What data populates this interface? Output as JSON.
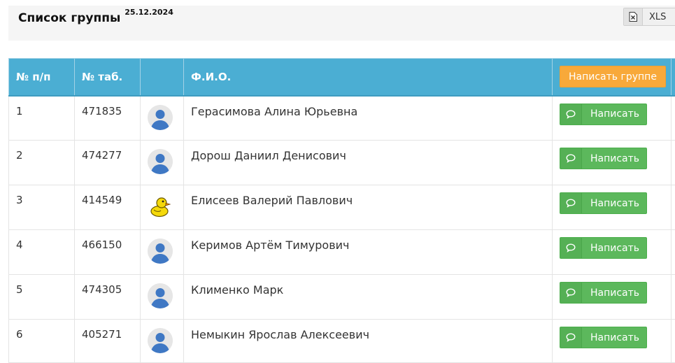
{
  "header": {
    "title": "Список группы",
    "date": "25.12.2024",
    "export_label": "XLS"
  },
  "table": {
    "columns": [
      "№ п/п",
      "№ таб.",
      "",
      "Ф.И.О."
    ],
    "group_button": "Написать группе",
    "write_label": "Написать",
    "rows": [
      {
        "num": "1",
        "tab": "471835",
        "name": "Герасимова Алина Юрьевна",
        "avatar": "default-avatar-icon"
      },
      {
        "num": "2",
        "tab": "474277",
        "name": "Дорош Даниил Денисович",
        "avatar": "default-avatar-icon"
      },
      {
        "num": "3",
        "tab": "414549",
        "name": "Елисеев Валерий Павлович",
        "avatar": "duck-avatar-icon"
      },
      {
        "num": "4",
        "tab": "466150",
        "name": "Керимов Артём Тимурович",
        "avatar": "default-avatar-icon"
      },
      {
        "num": "5",
        "tab": "474305",
        "name": "Клименко Марк",
        "avatar": "default-avatar-icon"
      },
      {
        "num": "6",
        "tab": "405271",
        "name": "Немыкин Ярослав Алексеевич",
        "avatar": "default-avatar-icon"
      }
    ]
  },
  "colors": {
    "header_bg": "#4baed3",
    "link": "#3a78b5",
    "write_button": "#5cb85c",
    "group_button": "#f8a93a"
  }
}
